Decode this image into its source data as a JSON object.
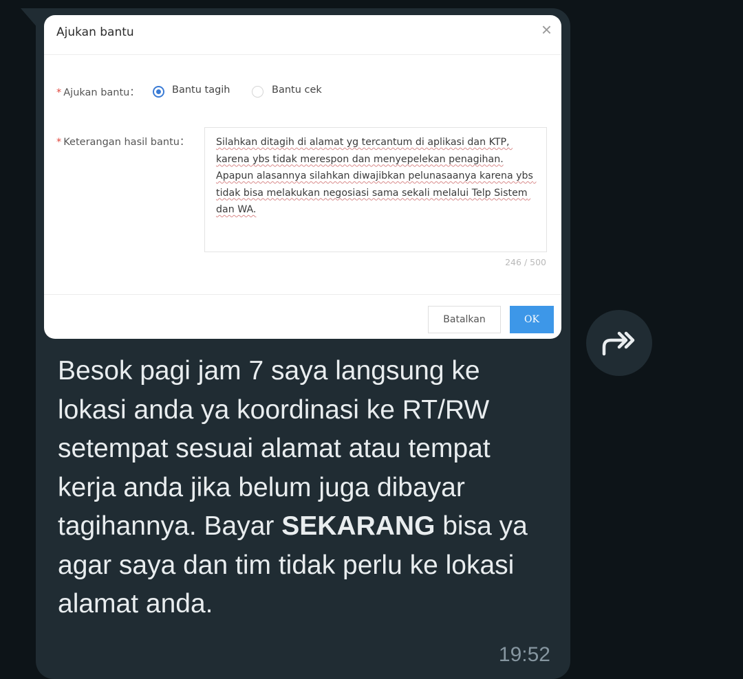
{
  "dialog": {
    "title": "Ajukan bantu",
    "close_glyph": "×",
    "field_type_label": "Ajukan bantu：",
    "required_mark": "*",
    "options": [
      {
        "label": "Bantu tagih",
        "selected": true
      },
      {
        "label": "Bantu cek",
        "selected": false
      }
    ],
    "field_note_label": "Keterangan hasil bantu：",
    "note_text": "Silahkan ditagih di alamat yg tercantum di aplikasi dan KTP, karena ybs tidak merespon dan menyepelekan penagihan.\nApapun alasannya silahkan diwajibkan pelunasaanya karena ybs tidak bisa melakukan negosiasi sama sekali melalui Telp Sistem dan WA.",
    "counter": "246 / 500",
    "cancel_label": "Batalkan",
    "ok_label": "OK"
  },
  "message": {
    "text_before": "Besok pagi jam 7 saya langsung ke lokasi anda ya koordinasi ke RT/RW setempat sesuai alamat atau tempat kerja anda jika belum juga dibayar tagihannya. Bayar ",
    "text_bold": "SEKARANG",
    "text_after": " bisa ya agar saya dan tim tidak perlu ke lokasi alamat anda.",
    "time": "19:52"
  },
  "icons": {
    "forward": "forward-icon"
  },
  "colors": {
    "bubble": "#202c33",
    "background": "#0d1418",
    "accent": "#3d97e8"
  }
}
